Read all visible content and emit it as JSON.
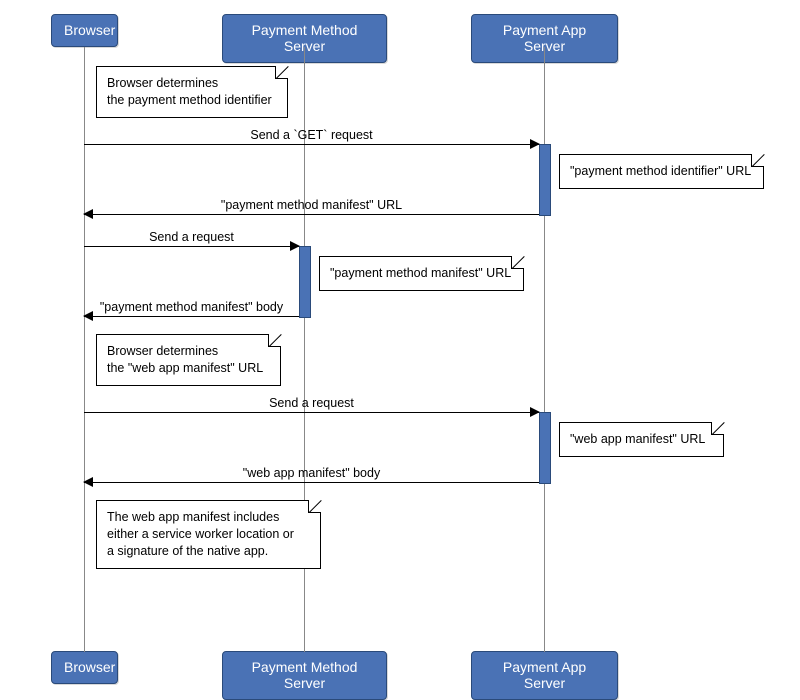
{
  "participants": {
    "browser": "Browser",
    "pms": "Payment Method Server",
    "pas": "Payment App Server"
  },
  "notes": {
    "n1_l1": "Browser determines",
    "n1_l2": "the payment method identifier",
    "n2": "\"payment method identifier\" URL",
    "n3": "\"payment method manifest\" URL",
    "n4_l1": "Browser determines",
    "n4_l2": "the \"web app manifest\" URL",
    "n5": "\"web app manifest\" URL",
    "n6_l1": "The web app manifest includes",
    "n6_l2": "either a service worker location or",
    "n6_l3": "a signature of the native app."
  },
  "messages": {
    "m1": "Send a `GET` request",
    "m2": "\"payment method manifest\" URL",
    "m3": "Send a request",
    "m4": "\"payment method manifest\" body",
    "m5": "Send a request",
    "m6": "\"web app manifest\" body"
  },
  "chart_data": {
    "type": "sequence-diagram",
    "participants": [
      "Browser",
      "Payment Method Server",
      "Payment App Server"
    ],
    "events": [
      {
        "kind": "note",
        "over": "Browser",
        "text": "Browser determines the payment method identifier"
      },
      {
        "kind": "message",
        "from": "Browser",
        "to": "Payment App Server",
        "label": "Send a `GET` request"
      },
      {
        "kind": "note",
        "over": "Payment App Server",
        "text": "\"payment method identifier\" URL"
      },
      {
        "kind": "message",
        "from": "Payment App Server",
        "to": "Browser",
        "label": "\"payment method manifest\" URL"
      },
      {
        "kind": "message",
        "from": "Browser",
        "to": "Payment Method Server",
        "label": "Send a request"
      },
      {
        "kind": "note",
        "over": "Payment Method Server",
        "text": "\"payment method manifest\" URL"
      },
      {
        "kind": "message",
        "from": "Payment Method Server",
        "to": "Browser",
        "label": "\"payment method manifest\" body"
      },
      {
        "kind": "note",
        "over": "Browser",
        "text": "Browser determines the \"web app manifest\" URL"
      },
      {
        "kind": "message",
        "from": "Browser",
        "to": "Payment App Server",
        "label": "Send a request"
      },
      {
        "kind": "note",
        "over": "Payment App Server",
        "text": "\"web app manifest\" URL"
      },
      {
        "kind": "message",
        "from": "Payment App Server",
        "to": "Browser",
        "label": "\"web app manifest\" body"
      },
      {
        "kind": "note",
        "over": "Browser",
        "text": "The web app manifest includes either a service worker location or a signature of the native app."
      }
    ]
  }
}
